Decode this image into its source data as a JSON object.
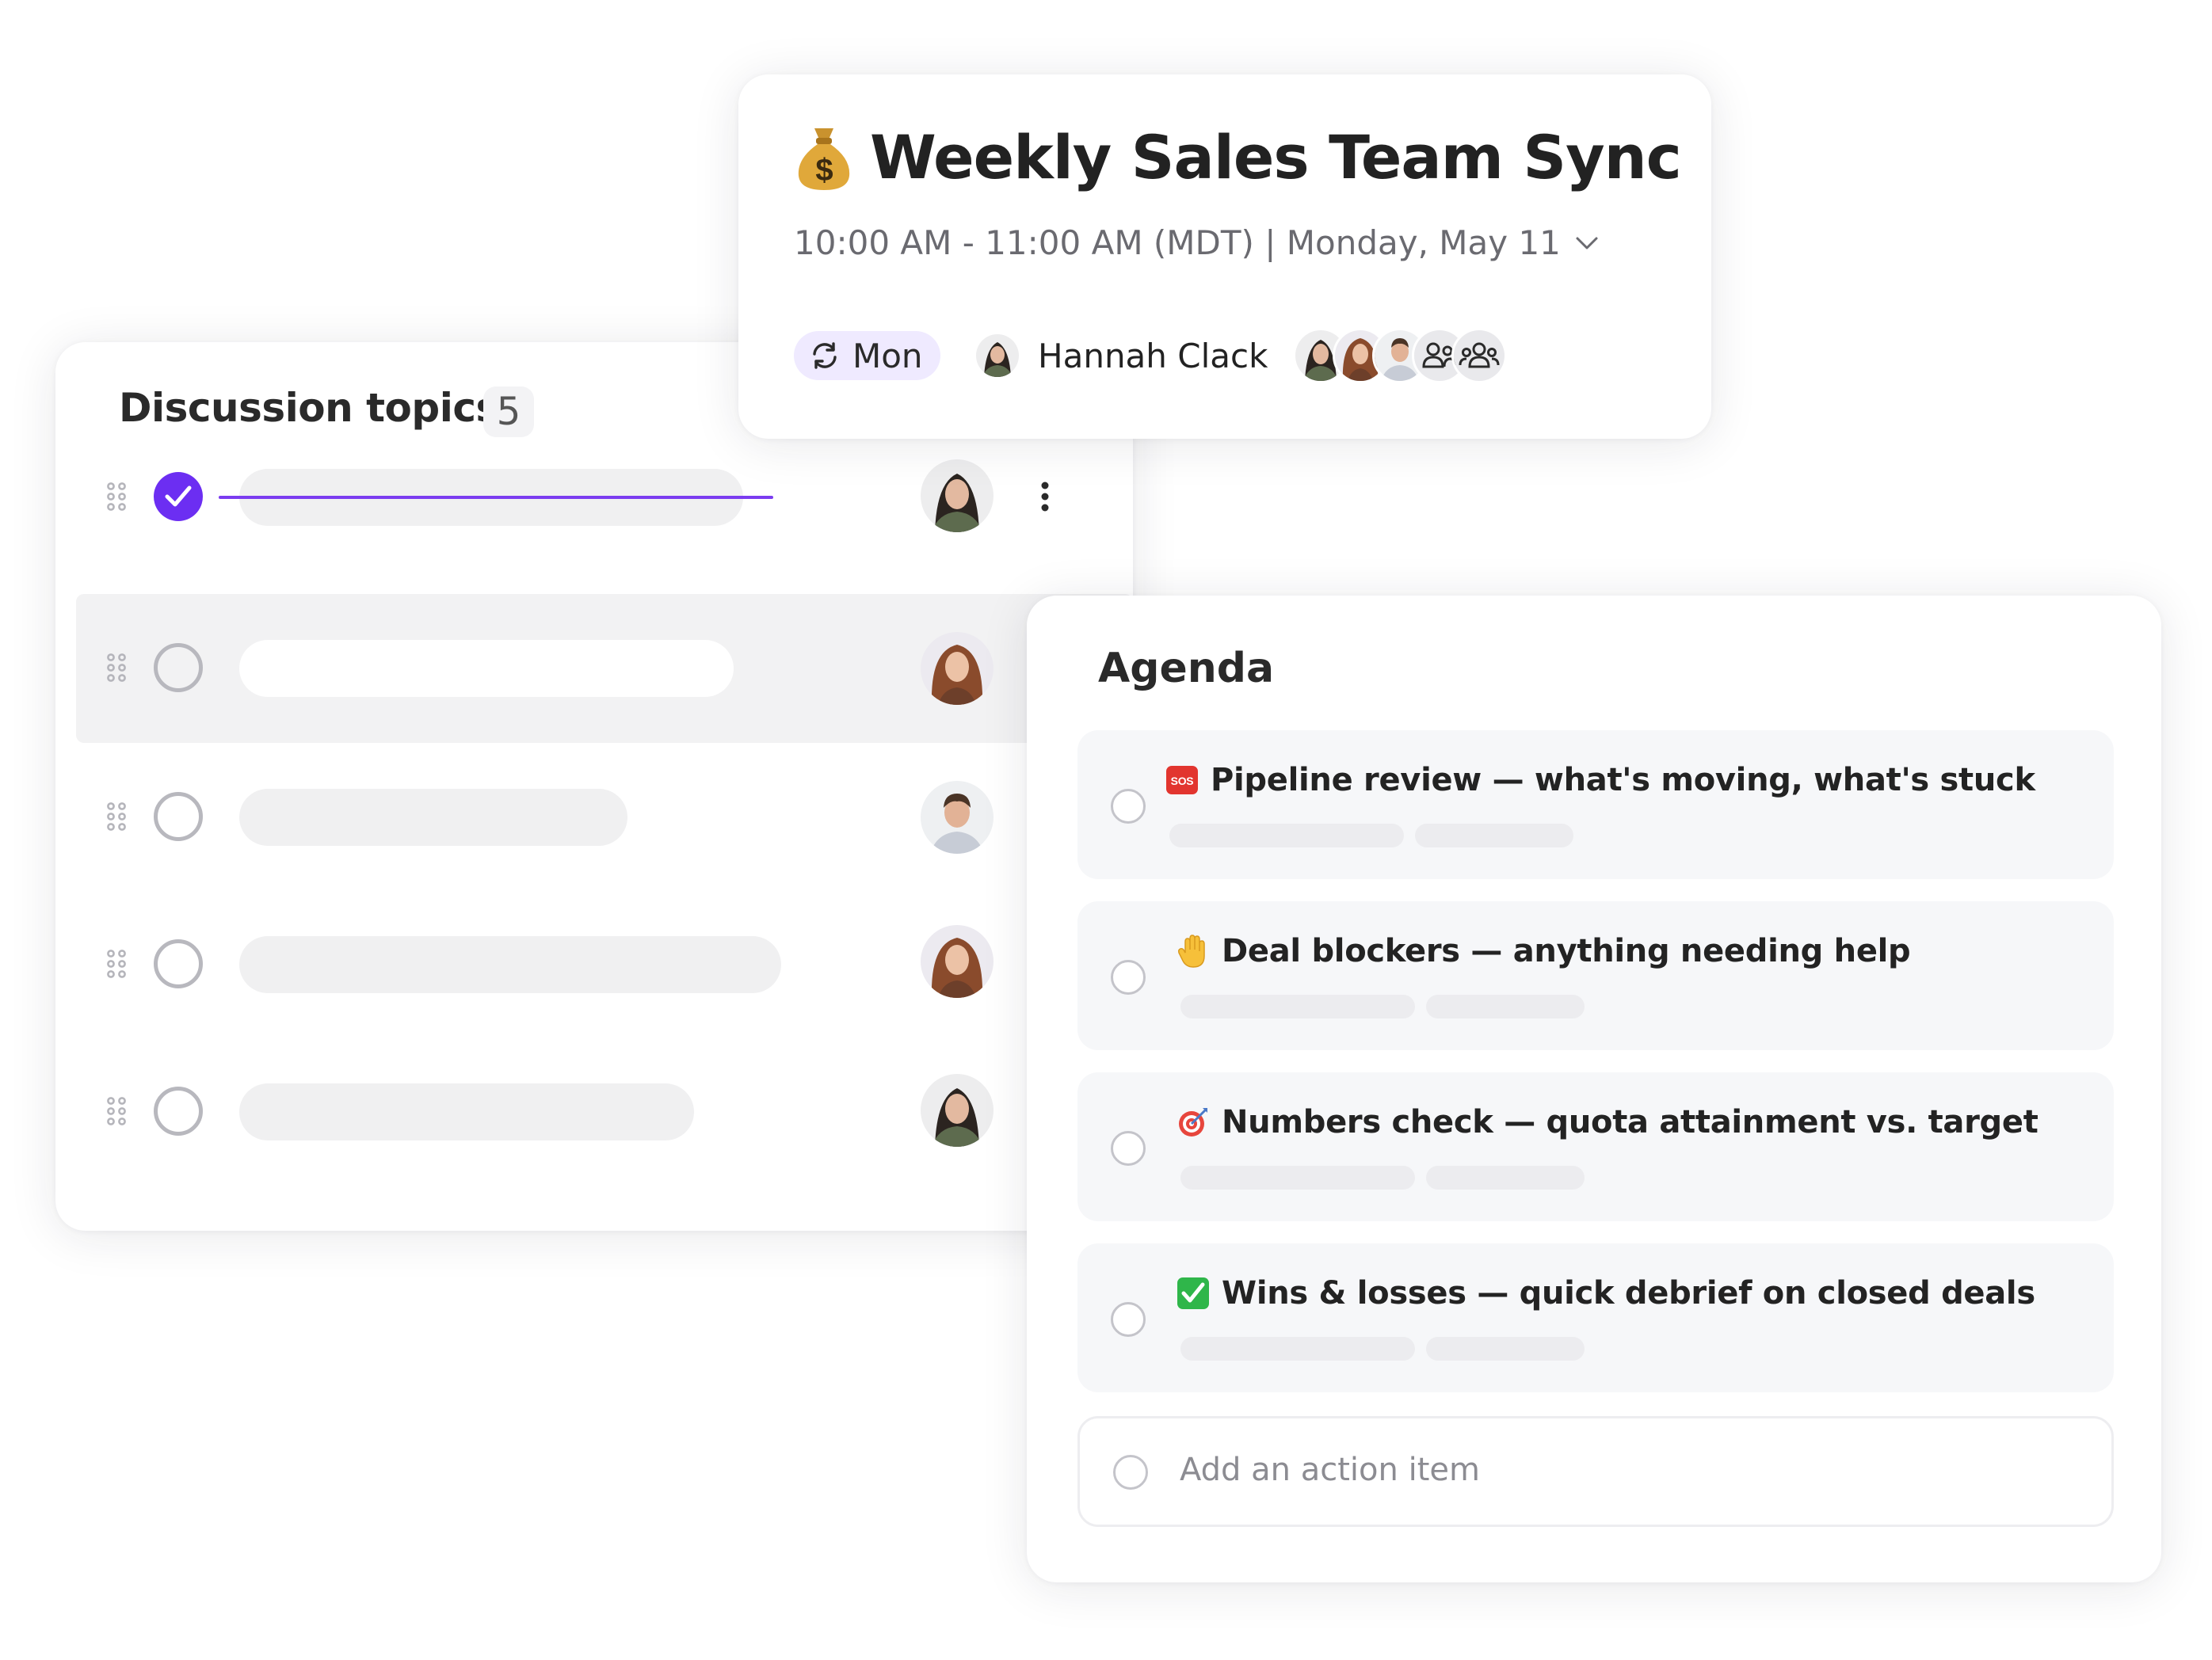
{
  "meeting": {
    "title": "Weekly Sales Team Sync",
    "title_icon": "money-bag-icon",
    "time_range": "10:00 AM - 11:00 AM (MDT) | Monday, May 11",
    "recurrence_label": "Mon",
    "owner_name": "Hannah Clack"
  },
  "discussion": {
    "title": "Discussion topics",
    "count": "5",
    "topics": [
      {
        "done": true
      },
      {
        "done": false
      },
      {
        "done": false
      },
      {
        "done": false
      },
      {
        "done": false
      }
    ]
  },
  "agenda": {
    "title": "Agenda",
    "items": [
      {
        "icon": "sos-icon",
        "label": "Pipeline review — what's moving, what's stuck"
      },
      {
        "icon": "raised-hand-icon",
        "label": "Deal blockers — anything needing help"
      },
      {
        "icon": "target-icon",
        "label": "Numbers check — quota attainment vs. target"
      },
      {
        "icon": "check-mark-button-icon",
        "label": "Wins & losses — quick debrief on closed deals"
      }
    ],
    "add_action_placeholder": "Add an action item"
  },
  "colors": {
    "accent": "#6c2ef2",
    "recurrence_chip": "#efeaff",
    "highlight_row": "#f2f2f3"
  }
}
